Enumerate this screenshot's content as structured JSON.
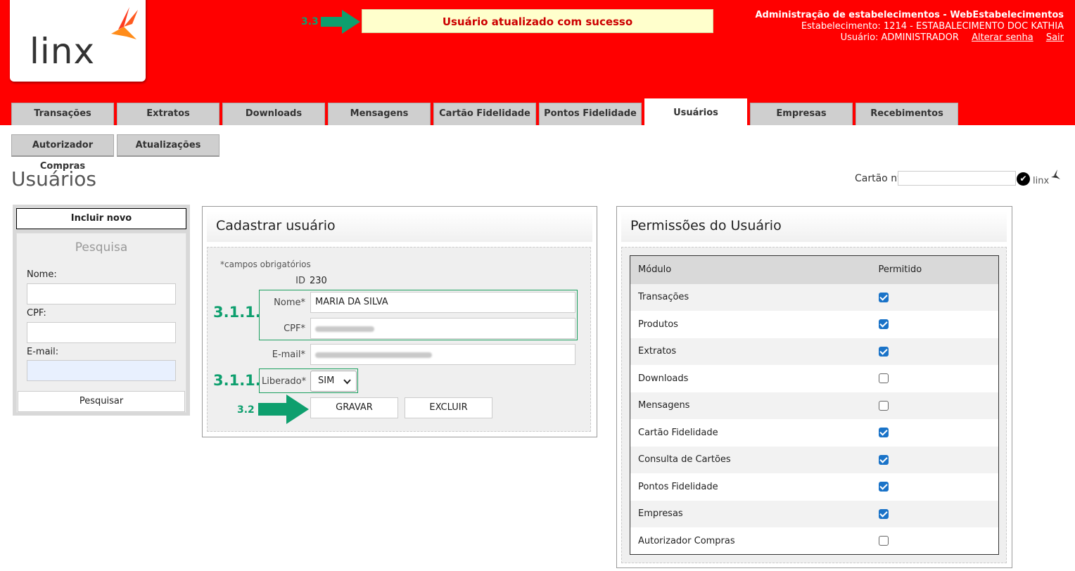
{
  "header": {
    "logo_text": "linx",
    "success_message": "Usuário atualizado com sucesso",
    "admin_title": "Administração de estabelecimentos - WebEstabelecimentos",
    "establishment": "Estabelecimento: 1214 - ESTABALECIMENTO DOC KATHIA",
    "user": "Usuário: ADMINISTRADOR",
    "change_password": "Alterar senha",
    "logout": "Sair"
  },
  "annotations": {
    "success_step": "3.3",
    "name_cpf_step": "3.1.1.",
    "liberado_step": "3.1.1.",
    "save_step": "3.2",
    "color": "#0e9f6e"
  },
  "tabs": [
    "Transações",
    "Extratos",
    "Downloads",
    "Mensagens",
    "Cartão Fidelidade",
    "Pontos Fidelidade",
    "Usuários",
    "Empresas",
    "Recebimentos"
  ],
  "active_tab": "Usuários",
  "subtabs": [
    "Autorizador Compras",
    "Atualizações"
  ],
  "page_title": "Usuários",
  "card_search": {
    "label": "Cartão nº",
    "value": ""
  },
  "mini_logo": "linx",
  "search_panel": {
    "new_button": "Incluir novo",
    "title": "Pesquisa",
    "name_label": "Nome:",
    "cpf_label": "CPF:",
    "email_label": "E-mail:",
    "search_button": "Pesquisar"
  },
  "register_form": {
    "title": "Cadastrar usuário",
    "required_note": "*campos obrigatórios",
    "id_label": "ID",
    "id_value": "230",
    "name_label": "Nome*",
    "name_value": "MARIA DA SILVA",
    "cpf_label": "CPF*",
    "email_label": "E-mail*",
    "liberado_label": "Liberado*",
    "liberado_value": "SIM",
    "save_button": "GRAVAR",
    "delete_button": "EXCLUIR"
  },
  "permissions": {
    "title": "Permissões do Usuário",
    "col_module": "Módulo",
    "col_allowed": "Permitido",
    "rows": [
      {
        "module": "Transações",
        "allowed": true
      },
      {
        "module": "Produtos",
        "allowed": true
      },
      {
        "module": "Extratos",
        "allowed": true
      },
      {
        "module": "Downloads",
        "allowed": false
      },
      {
        "module": "Mensagens",
        "allowed": false
      },
      {
        "module": "Cartão Fidelidade",
        "allowed": true
      },
      {
        "module": "Consulta de Cartões",
        "allowed": true
      },
      {
        "module": "Pontos Fidelidade",
        "allowed": true
      },
      {
        "module": "Empresas",
        "allowed": true
      },
      {
        "module": "Autorizador Compras",
        "allowed": false
      }
    ]
  },
  "colors": {
    "header_bg": "#ff0000",
    "success_bg": "#ffffcc",
    "success_text": "#cc0000",
    "annotation_green": "#0e9f6e",
    "checkbox_blue": "#1a73c8"
  }
}
